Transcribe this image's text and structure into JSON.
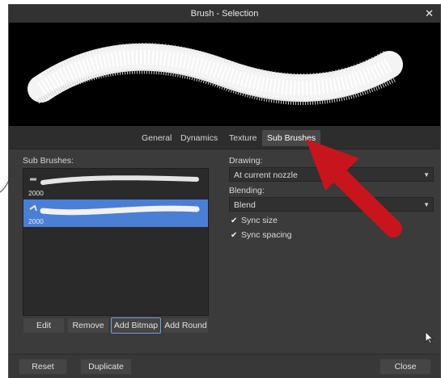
{
  "window": {
    "title": "Brush - Selection"
  },
  "tabs": [
    "General",
    "Dynamics",
    "Texture",
    "Sub Brushes"
  ],
  "active_tab": "Sub Brushes",
  "sub_brushes": {
    "label": "Sub Brushes:",
    "items": [
      {
        "size": "2000",
        "selected": false
      },
      {
        "size": "2000",
        "selected": true
      }
    ],
    "buttons": {
      "edit": "Edit",
      "remove": "Remove",
      "add_bitmap": "Add Bitmap",
      "add_round": "Add Round"
    }
  },
  "drawing": {
    "label": "Drawing:",
    "value": "At current nozzle"
  },
  "blending": {
    "label": "Blending:",
    "value": "Blend"
  },
  "options": {
    "sync_size": "Sync size",
    "sync_spacing": "Sync spacing"
  },
  "footer": {
    "reset": "Reset",
    "duplicate": "Duplicate",
    "close": "Close"
  },
  "colors": {
    "accent": "#4a7fd6",
    "annotation_arrow": "#c8141c"
  }
}
